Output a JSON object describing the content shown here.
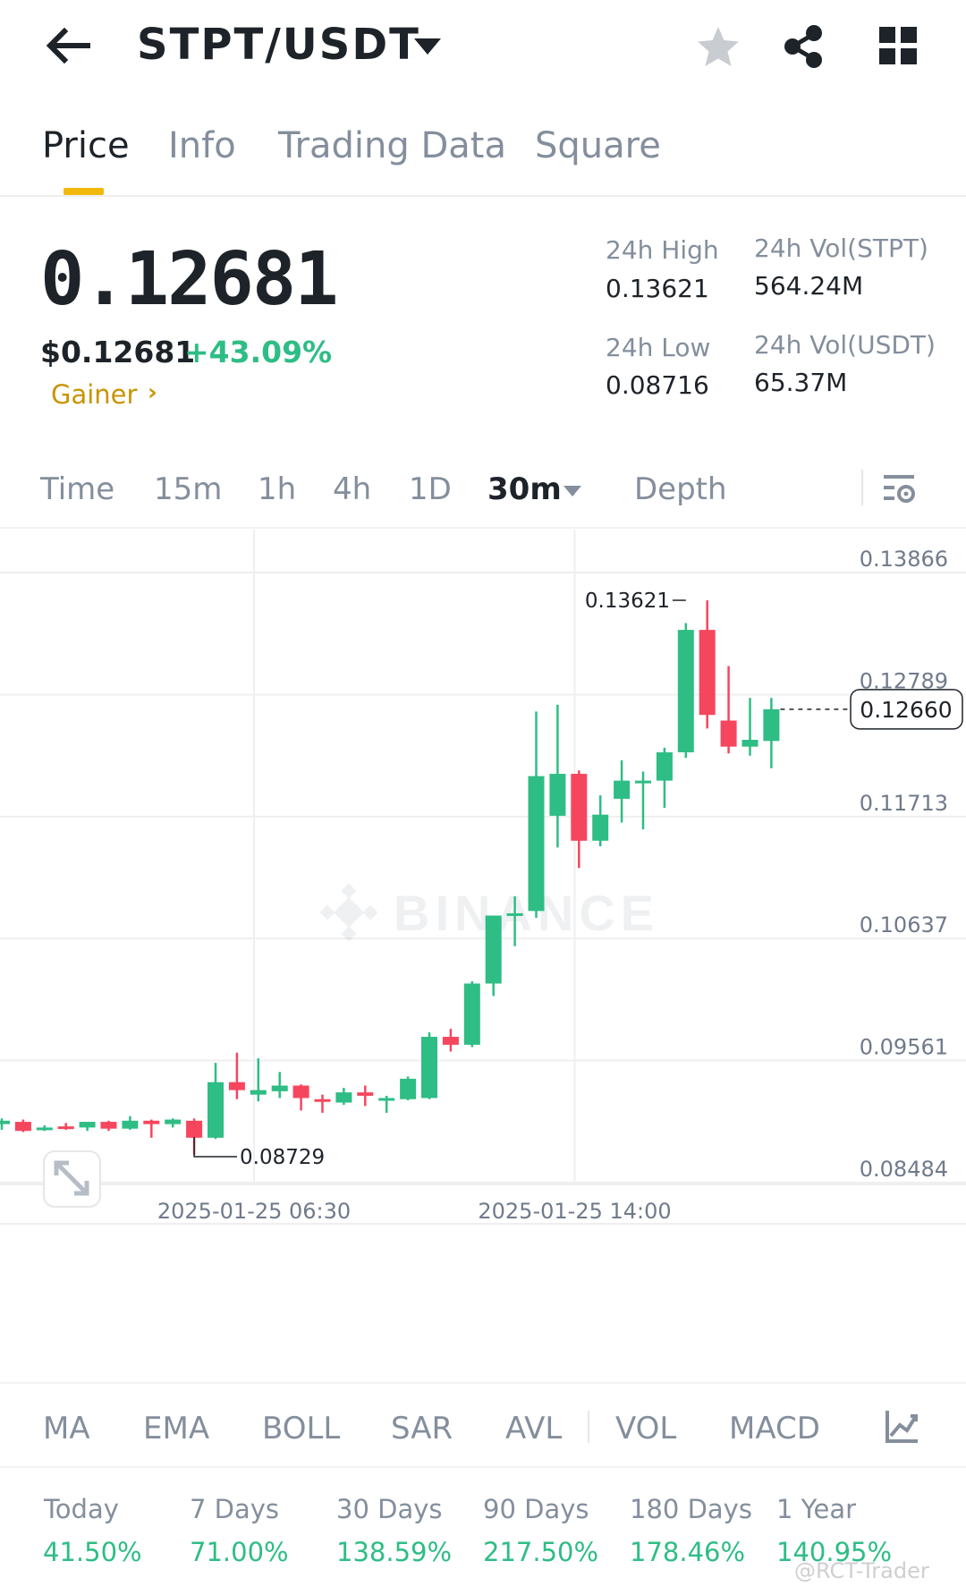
{
  "header": {
    "pair": "STPT/USDT",
    "icons": {
      "back": "back-arrow-icon",
      "caret": "caret-down-icon",
      "favorite": "star-icon",
      "share": "share-icon",
      "menu": "grid-icon"
    }
  },
  "tabs": [
    {
      "label": "Price",
      "active": true
    },
    {
      "label": "Info",
      "active": false
    },
    {
      "label": "Trading Data",
      "active": false
    },
    {
      "label": "Square",
      "active": false
    }
  ],
  "ticker": {
    "last_price": "0.12681",
    "usd_price": "$0.12681",
    "change_pct": "+43.09%",
    "tag": "Gainer",
    "tag_arrow": "›"
  },
  "stats": {
    "high_label": "24h High",
    "high_value": "0.13621",
    "low_label": "24h Low",
    "low_value": "0.08716",
    "vol_base_label": "24h Vol(STPT)",
    "vol_base_value": "564.24M",
    "vol_quote_label": "24h Vol(USDT)",
    "vol_quote_value": "65.37M"
  },
  "intervals": {
    "items": [
      "Time",
      "15m",
      "1h",
      "4h",
      "1D"
    ],
    "selected": "30m",
    "depth": "Depth"
  },
  "colors": {
    "up": "#2ebd85",
    "down": "#f6465d",
    "accent": "#f0b90b",
    "muted": "#848e9c",
    "grid": "#efefef"
  },
  "chart_data": {
    "type": "candlestick",
    "y_ticks": [
      "0.13866",
      "0.12789",
      "0.11713",
      "0.10637",
      "0.09561",
      "0.08484"
    ],
    "ylim": [
      0.08484,
      0.13866
    ],
    "x_ticks": [
      {
        "label": "2025-01-25 06:30",
        "index": 11.8
      },
      {
        "label": "2025-01-25 14:00",
        "index": 26.8
      }
    ],
    "current_price_label": "0.12660",
    "current_price": 0.1266,
    "max_label": "0.13621",
    "max_value": 0.13621,
    "max_index": 32,
    "min_label": "0.08729",
    "min_value": 0.08729,
    "min_index": 9,
    "watermark": "BINANCE",
    "candles": [
      {
        "o": 0.09,
        "h": 0.0905,
        "l": 0.0895,
        "c": 0.0903
      },
      {
        "o": 0.0902,
        "h": 0.0904,
        "l": 0.0893,
        "c": 0.0894
      },
      {
        "o": 0.0895,
        "h": 0.0899,
        "l": 0.0894,
        "c": 0.0897
      },
      {
        "o": 0.0898,
        "h": 0.0901,
        "l": 0.0895,
        "c": 0.0896
      },
      {
        "o": 0.0897,
        "h": 0.0902,
        "l": 0.0894,
        "c": 0.0902
      },
      {
        "o": 0.0902,
        "h": 0.0903,
        "l": 0.0894,
        "c": 0.0896
      },
      {
        "o": 0.0896,
        "h": 0.0907,
        "l": 0.0895,
        "c": 0.0903
      },
      {
        "o": 0.0903,
        "h": 0.0904,
        "l": 0.0888,
        "c": 0.09
      },
      {
        "o": 0.09,
        "h": 0.0905,
        "l": 0.0897,
        "c": 0.0904
      },
      {
        "o": 0.0903,
        "h": 0.0905,
        "l": 0.0873,
        "c": 0.0888
      },
      {
        "o": 0.0888,
        "h": 0.0954,
        "l": 0.0887,
        "c": 0.0937
      },
      {
        "o": 0.0937,
        "h": 0.0963,
        "l": 0.0922,
        "c": 0.093
      },
      {
        "o": 0.0926,
        "h": 0.0958,
        "l": 0.092,
        "c": 0.093
      },
      {
        "o": 0.0929,
        "h": 0.0946,
        "l": 0.0923,
        "c": 0.0934
      },
      {
        "o": 0.0934,
        "h": 0.0935,
        "l": 0.0912,
        "c": 0.0923
      },
      {
        "o": 0.0922,
        "h": 0.0926,
        "l": 0.091,
        "c": 0.092
      },
      {
        "o": 0.0919,
        "h": 0.0932,
        "l": 0.0917,
        "c": 0.0928
      },
      {
        "o": 0.0928,
        "h": 0.0934,
        "l": 0.0916,
        "c": 0.0925
      },
      {
        "o": 0.0921,
        "h": 0.0925,
        "l": 0.091,
        "c": 0.0923
      },
      {
        "o": 0.0922,
        "h": 0.0942,
        "l": 0.0921,
        "c": 0.094
      },
      {
        "o": 0.0923,
        "h": 0.0981,
        "l": 0.0922,
        "c": 0.0977
      },
      {
        "o": 0.0977,
        "h": 0.0984,
        "l": 0.0964,
        "c": 0.097
      },
      {
        "o": 0.097,
        "h": 0.1026,
        "l": 0.0968,
        "c": 0.1024
      },
      {
        "o": 0.1024,
        "h": 0.1077,
        "l": 0.1013,
        "c": 0.1084
      },
      {
        "o": 0.1084,
        "h": 0.1101,
        "l": 0.1057,
        "c": 0.1086
      },
      {
        "o": 0.1088,
        "h": 0.1264,
        "l": 0.1082,
        "c": 0.1207
      },
      {
        "o": 0.1172,
        "h": 0.127,
        "l": 0.1144,
        "c": 0.1209
      },
      {
        "o": 0.1209,
        "h": 0.1212,
        "l": 0.1126,
        "c": 0.115
      },
      {
        "o": 0.115,
        "h": 0.119,
        "l": 0.1145,
        "c": 0.1173
      },
      {
        "o": 0.1187,
        "h": 0.1221,
        "l": 0.1166,
        "c": 0.1203
      },
      {
        "o": 0.1203,
        "h": 0.1211,
        "l": 0.116,
        "c": 0.1203
      },
      {
        "o": 0.1203,
        "h": 0.1232,
        "l": 0.1179,
        "c": 0.1228
      },
      {
        "o": 0.1228,
        "h": 0.1342,
        "l": 0.1223,
        "c": 0.1336
      },
      {
        "o": 0.1336,
        "h": 0.1362,
        "l": 0.1249,
        "c": 0.1261
      },
      {
        "o": 0.1256,
        "h": 0.1304,
        "l": 0.1227,
        "c": 0.1233
      },
      {
        "o": 0.1233,
        "h": 0.1276,
        "l": 0.1225,
        "c": 0.1239
      },
      {
        "o": 0.1238,
        "h": 0.1276,
        "l": 0.1214,
        "c": 0.1266
      }
    ]
  },
  "indicators": [
    "MA",
    "EMA",
    "BOLL",
    "SAR",
    "AVL",
    "VOL",
    "MACD"
  ],
  "performance": [
    {
      "label": "Today",
      "value": "41.50%"
    },
    {
      "label": "7 Days",
      "value": "71.00%"
    },
    {
      "label": "30 Days",
      "value": "138.59%"
    },
    {
      "label": "90 Days",
      "value": "217.50%"
    },
    {
      "label": "180 Days",
      "value": "178.46%"
    },
    {
      "label": "1 Year",
      "value": "140.95%"
    }
  ],
  "credit": "@RCT-Trader"
}
